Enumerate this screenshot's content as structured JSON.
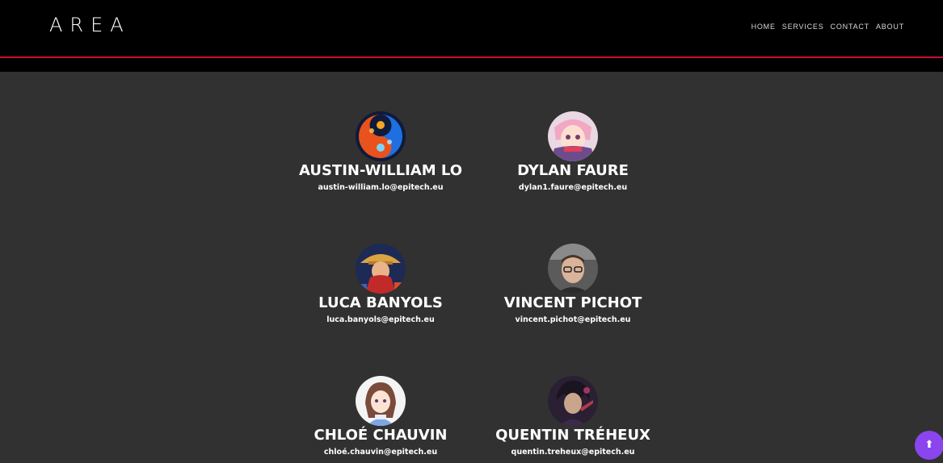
{
  "header": {
    "logo": "AREA",
    "nav": [
      "HOME",
      "SERVICES",
      "CONTACT",
      "ABOUT"
    ]
  },
  "team": [
    {
      "name": "AUSTIN-WILLIAM LO",
      "email": "austin-william.lo@epitech.eu"
    },
    {
      "name": "DYLAN FAURE",
      "email": "dylan1.faure@epitech.eu"
    },
    {
      "name": "LUCA BANYOLS",
      "email": "luca.banyols@epitech.eu"
    },
    {
      "name": "VINCENT PICHOT",
      "email": "vincent.pichot@epitech.eu"
    },
    {
      "name": "CHLOÉ CHAUVIN",
      "email": "chloé.chauvin@epitech.eu"
    },
    {
      "name": "QUENTIN TRÉHEUX",
      "email": "quentin.treheux@epitech.eu"
    }
  ],
  "scroll_top": {
    "icon": "arrow-up-icon",
    "glyph": "⬆"
  },
  "colors": {
    "header_bg": "#000000",
    "accent_line": "#c8102e",
    "page_bg": "#313131",
    "scroll_button": "#8b45ee"
  }
}
